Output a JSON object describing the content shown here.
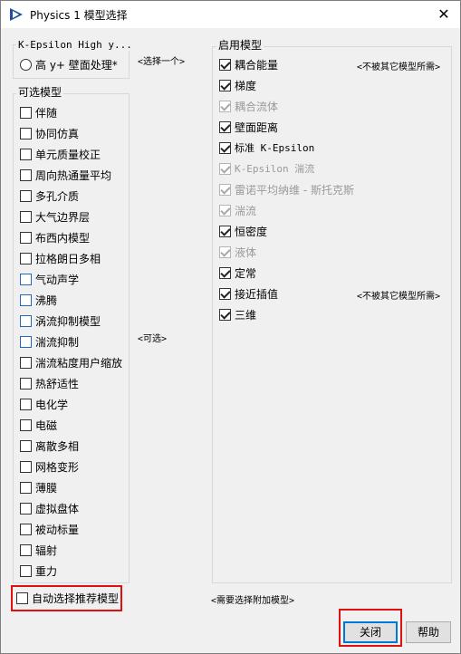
{
  "window": {
    "title": "Physics 1 模型选择",
    "close_glyph": "✕"
  },
  "top_group": {
    "title": "K-Epsilon High y...",
    "radio_label": "高 y+ 壁面处理*"
  },
  "select_one_note": "<选择一个>",
  "optional_group": {
    "title": "可选模型",
    "items": [
      {
        "label": "伴随",
        "checked": false,
        "blue": false
      },
      {
        "label": "协同仿真",
        "checked": false,
        "blue": false
      },
      {
        "label": "单元质量校正",
        "checked": false,
        "blue": false
      },
      {
        "label": "周向热通量平均",
        "checked": false,
        "blue": false
      },
      {
        "label": "多孔介质",
        "checked": false,
        "blue": false
      },
      {
        "label": "大气边界层",
        "checked": false,
        "blue": false
      },
      {
        "label": "布西内模型",
        "checked": false,
        "blue": false
      },
      {
        "label": "拉格朗日多相",
        "checked": false,
        "blue": false
      },
      {
        "label": "气动声学",
        "checked": false,
        "blue": true
      },
      {
        "label": "沸腾",
        "checked": false,
        "blue": true
      },
      {
        "label": "涡流抑制模型",
        "checked": false,
        "blue": true
      },
      {
        "label": "湍流抑制",
        "checked": false,
        "blue": true
      },
      {
        "label": "湍流粘度用户缩放",
        "checked": false,
        "blue": false
      },
      {
        "label": "热舒适性",
        "checked": false,
        "blue": false
      },
      {
        "label": "电化学",
        "checked": false,
        "blue": false
      },
      {
        "label": "电磁",
        "checked": false,
        "blue": false
      },
      {
        "label": "离散多相",
        "checked": false,
        "blue": false
      },
      {
        "label": "网格变形",
        "checked": false,
        "blue": false
      },
      {
        "label": "薄膜",
        "checked": false,
        "blue": false
      },
      {
        "label": "虚拟盘体",
        "checked": false,
        "blue": false
      },
      {
        "label": "被动标量",
        "checked": false,
        "blue": false
      },
      {
        "label": "辐射",
        "checked": false,
        "blue": false
      },
      {
        "label": "重力",
        "checked": false,
        "blue": false
      }
    ]
  },
  "optional_note": "<可选>",
  "enabled_group": {
    "title": "启用模型",
    "items": [
      {
        "label": "耦合能量",
        "checked": true,
        "disabled": false,
        "note": "<不被其它模型所需>"
      },
      {
        "label": "梯度",
        "checked": true,
        "disabled": false,
        "note": ""
      },
      {
        "label": "耦合流体",
        "checked": true,
        "disabled": true,
        "note": ""
      },
      {
        "label": "壁面距离",
        "checked": true,
        "disabled": false,
        "note": ""
      },
      {
        "label": "标准 K-Epsilon",
        "checked": true,
        "disabled": false,
        "note": ""
      },
      {
        "label": "K-Epsilon 湍流",
        "checked": true,
        "disabled": true,
        "note": ""
      },
      {
        "label": "雷诺平均纳维 - 斯托克斯",
        "checked": true,
        "disabled": true,
        "note": ""
      },
      {
        "label": "湍流",
        "checked": true,
        "disabled": true,
        "note": ""
      },
      {
        "label": "恒密度",
        "checked": true,
        "disabled": false,
        "note": ""
      },
      {
        "label": "液体",
        "checked": true,
        "disabled": true,
        "note": ""
      },
      {
        "label": "定常",
        "checked": true,
        "disabled": false,
        "note": ""
      },
      {
        "label": "接近插值",
        "checked": true,
        "disabled": false,
        "note": "<不被其它模型所需>"
      },
      {
        "label": "三维",
        "checked": true,
        "disabled": false,
        "note": ""
      }
    ]
  },
  "auto_select_label": "自动选择推荐模型",
  "need_more_note": "<需要选择附加模型>",
  "buttons": {
    "close_label": "关闭",
    "help_label": "帮助"
  },
  "colors": {
    "highlight_red": "#e01010",
    "window_bg": "#f0f0f0",
    "focus_blue": "#0078d7"
  }
}
